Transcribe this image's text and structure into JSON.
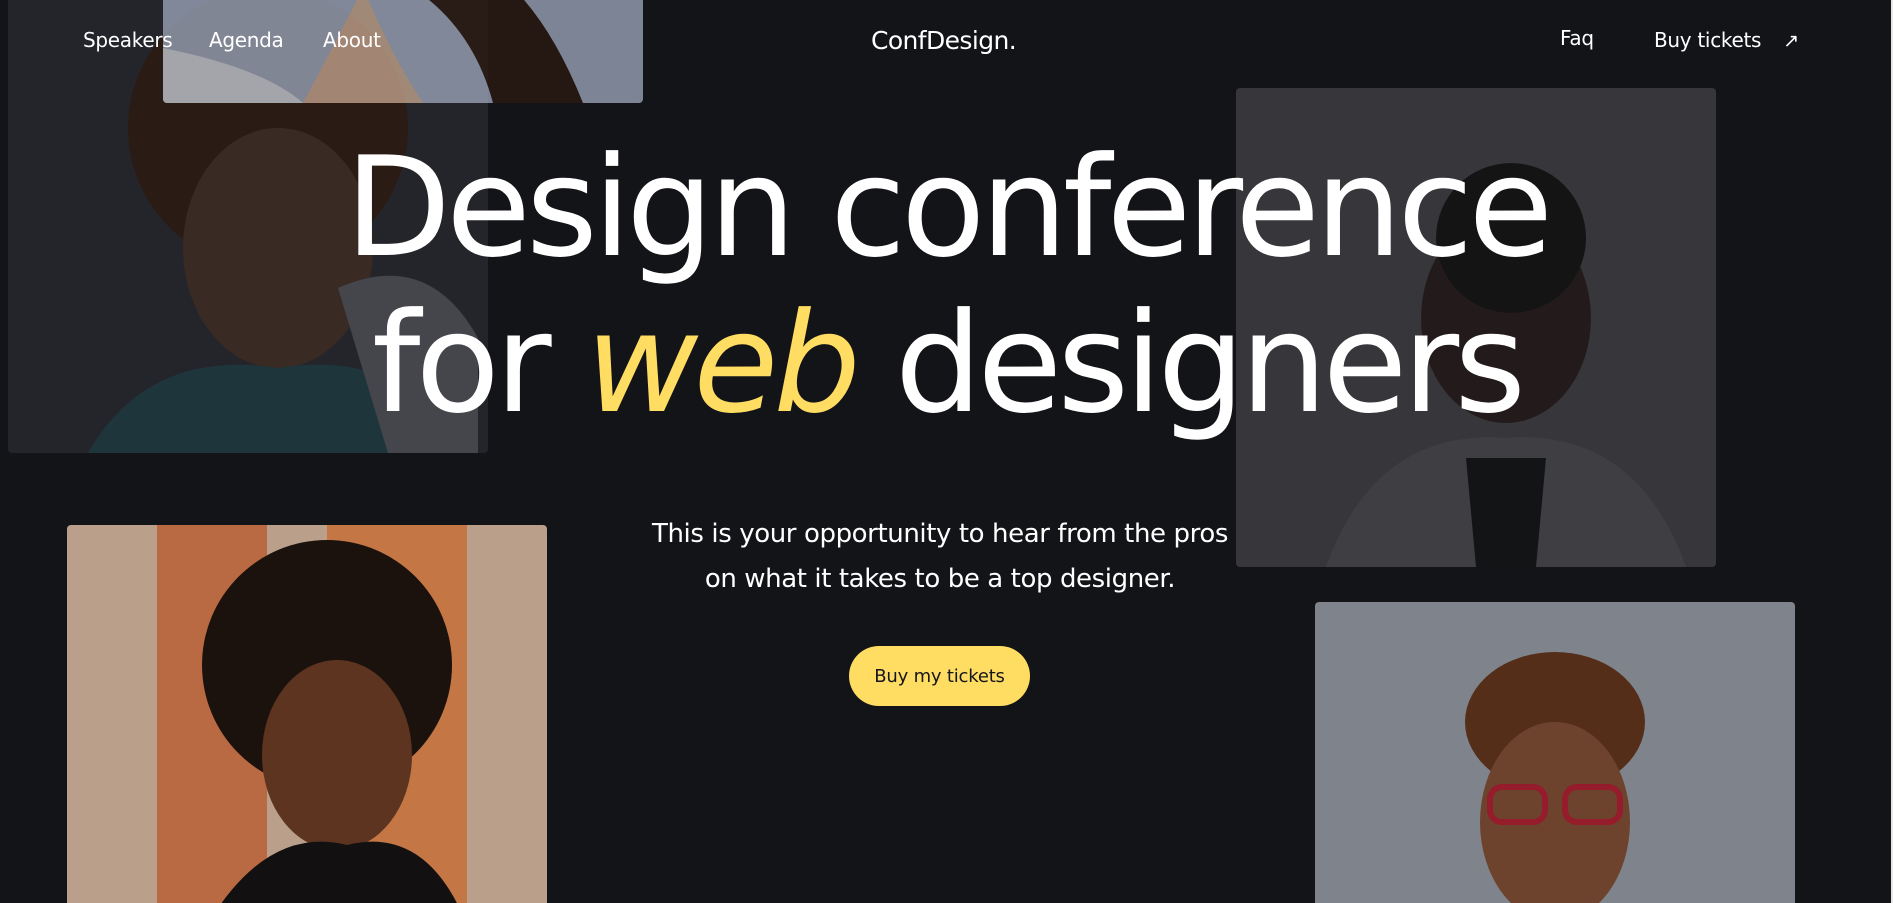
{
  "nav": {
    "left": [
      "Speakers",
      "Agenda",
      "About"
    ],
    "logo": "ConfDesign.",
    "faq": "Faq",
    "buy_tickets": "Buy tickets",
    "buy_arrow_icon": "arrow-up-right-icon"
  },
  "hero": {
    "line1": "Design conference",
    "line2_before": "for ",
    "line2_accent": "web",
    "line2_after": " designers"
  },
  "subtitle": {
    "line1": "This is your opportunity to hear from the pros",
    "line2": "on what it takes to be a top designer."
  },
  "cta": {
    "label": "Buy my tickets"
  },
  "colors": {
    "background": "#131418",
    "accent": "#ffdc62",
    "text": "#ffffff"
  }
}
